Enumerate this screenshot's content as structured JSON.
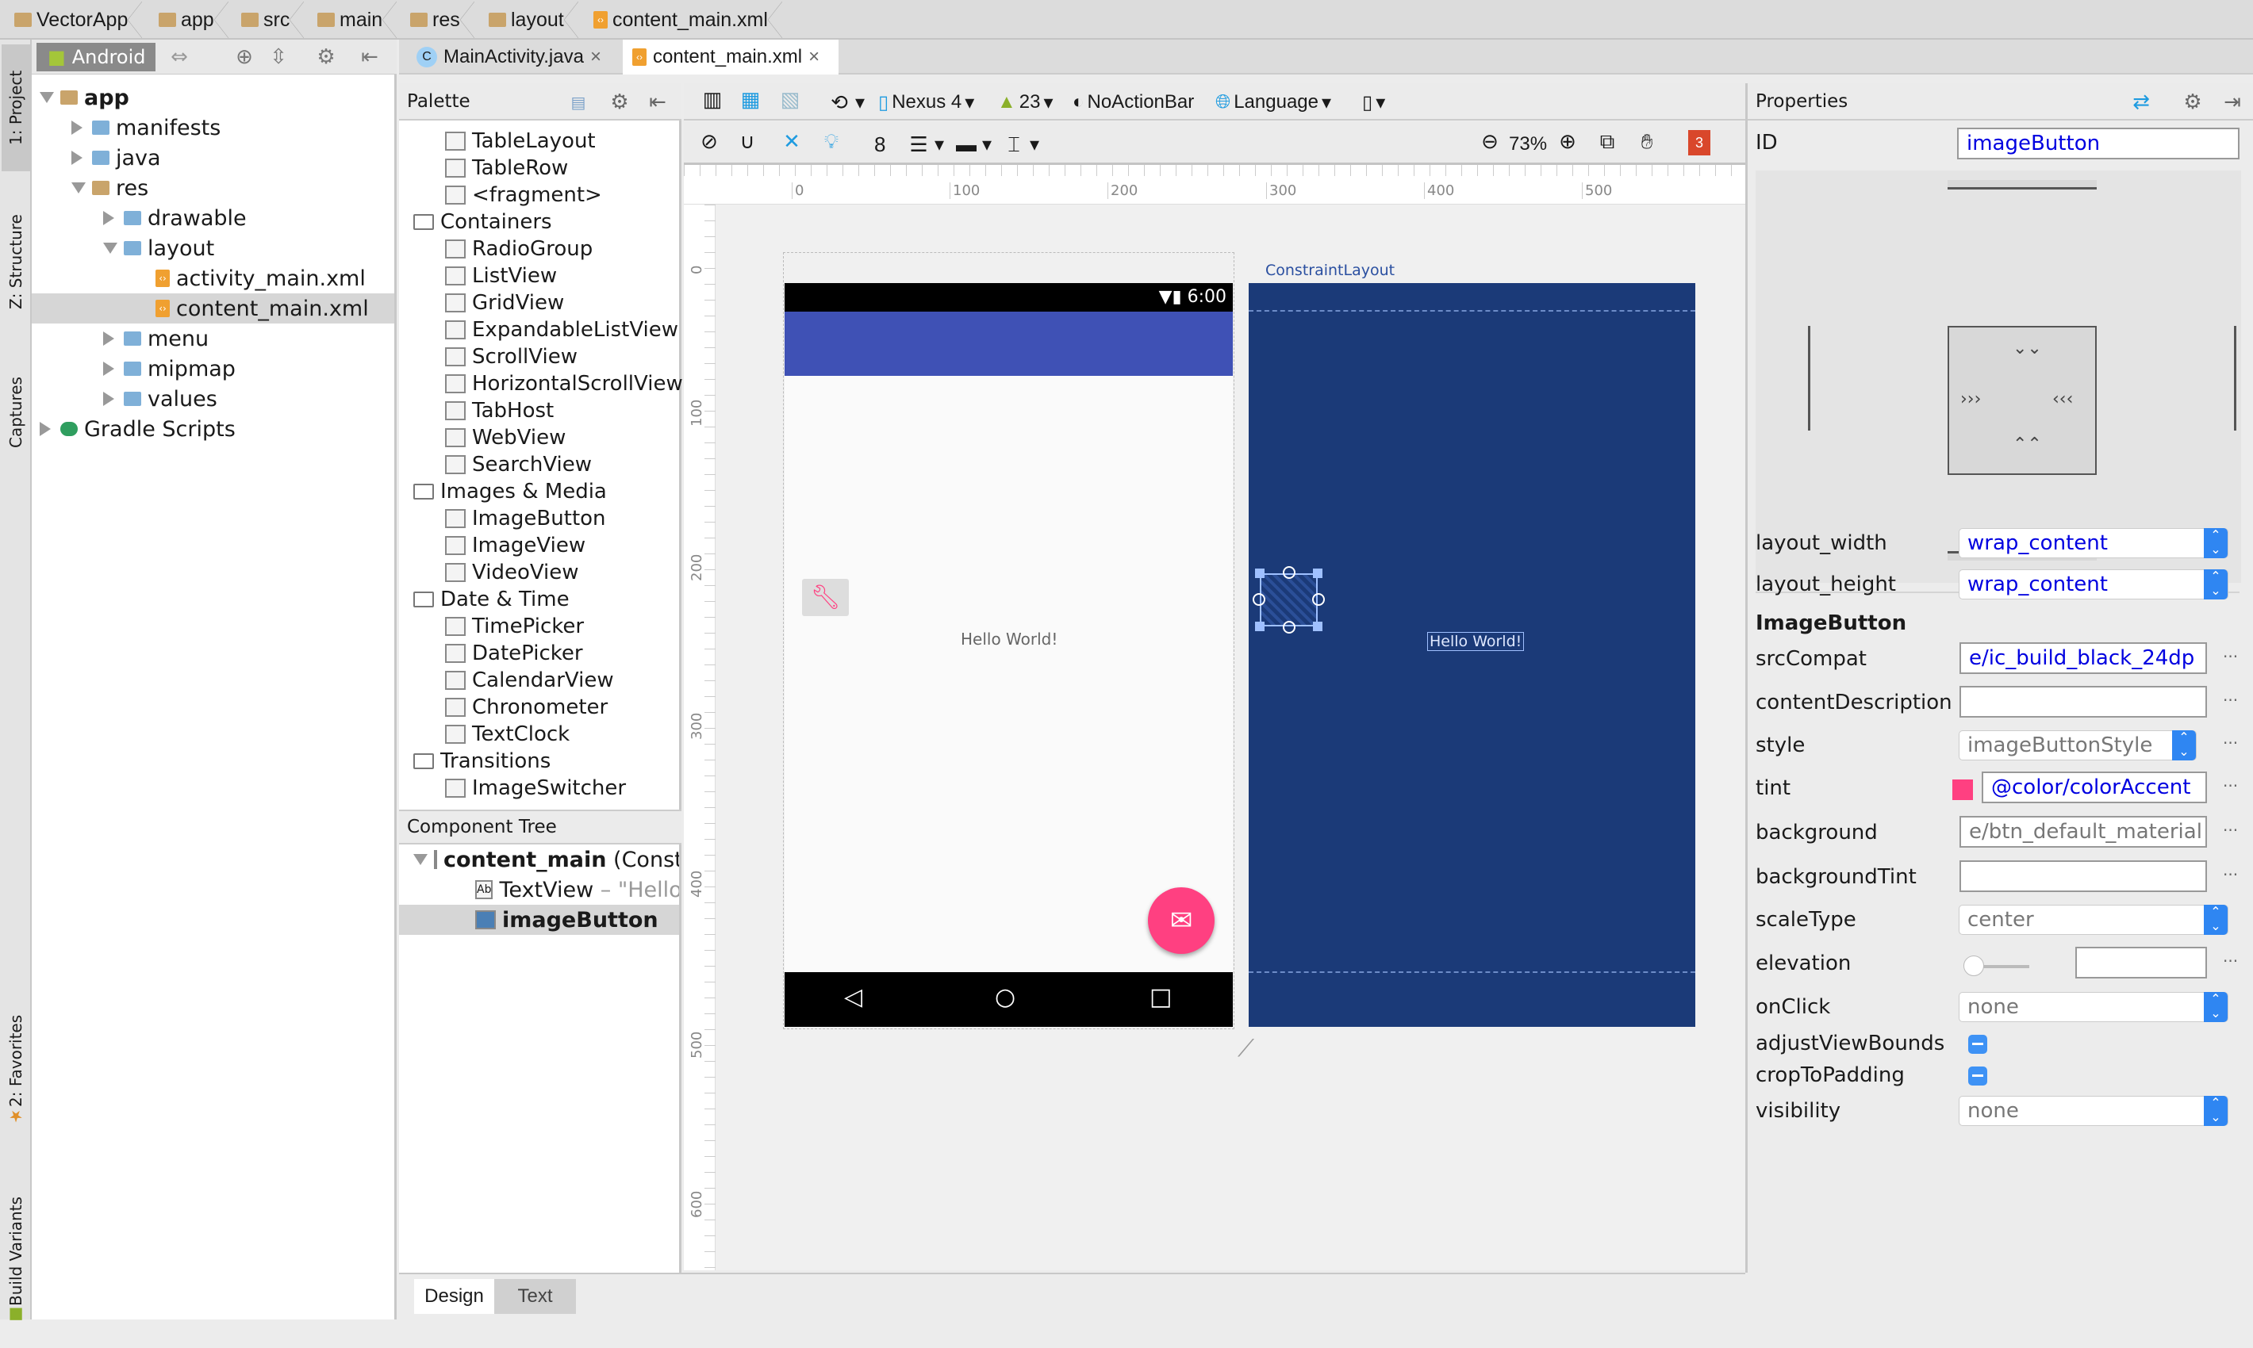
{
  "breadcrumbs": [
    "VectorApp",
    "app",
    "src",
    "main",
    "res",
    "layout",
    "content_main.xml"
  ],
  "tool_strip": {
    "project": "1: Project",
    "structure": "Z: Structure",
    "captures": "Captures",
    "favorites": "2: Favorites",
    "build_variants": "Build Variants"
  },
  "project": {
    "view_mode": "Android",
    "tree": [
      {
        "label": "app",
        "level": 0,
        "state": "open",
        "bold": true,
        "icon": "module-folder"
      },
      {
        "label": "manifests",
        "level": 1,
        "state": "closed",
        "icon": "folder"
      },
      {
        "label": "java",
        "level": 1,
        "state": "closed",
        "icon": "folder"
      },
      {
        "label": "res",
        "level": 1,
        "state": "open",
        "icon": "res-folder"
      },
      {
        "label": "drawable",
        "level": 2,
        "state": "closed",
        "icon": "folder"
      },
      {
        "label": "layout",
        "level": 2,
        "state": "open",
        "icon": "folder"
      },
      {
        "label": "activity_main.xml",
        "level": 3,
        "state": "leaf",
        "icon": "xml-file"
      },
      {
        "label": "content_main.xml",
        "level": 3,
        "state": "leaf",
        "icon": "xml-file",
        "selected": true
      },
      {
        "label": "menu",
        "level": 2,
        "state": "closed",
        "icon": "folder"
      },
      {
        "label": "mipmap",
        "level": 2,
        "state": "closed",
        "icon": "folder"
      },
      {
        "label": "values",
        "level": 2,
        "state": "closed",
        "icon": "folder"
      },
      {
        "label": "Gradle Scripts",
        "level": 0,
        "state": "closed",
        "icon": "gradle"
      }
    ]
  },
  "editor_tabs": [
    {
      "label": "MainActivity.java",
      "active": false
    },
    {
      "label": "content_main.xml",
      "active": true
    }
  ],
  "palette": {
    "title": "Palette",
    "items": [
      {
        "label": "TableLayout"
      },
      {
        "label": "TableRow"
      },
      {
        "label": "<fragment>"
      },
      {
        "label": "Containers",
        "group": true
      },
      {
        "label": "RadioGroup"
      },
      {
        "label": "ListView"
      },
      {
        "label": "GridView"
      },
      {
        "label": "ExpandableListView"
      },
      {
        "label": "ScrollView"
      },
      {
        "label": "HorizontalScrollView"
      },
      {
        "label": "TabHost"
      },
      {
        "label": "WebView"
      },
      {
        "label": "SearchView"
      },
      {
        "label": "Images & Media",
        "group": true
      },
      {
        "label": "ImageButton"
      },
      {
        "label": "ImageView"
      },
      {
        "label": "VideoView"
      },
      {
        "label": "Date & Time",
        "group": true
      },
      {
        "label": "TimePicker"
      },
      {
        "label": "DatePicker"
      },
      {
        "label": "CalendarView"
      },
      {
        "label": "Chronometer"
      },
      {
        "label": "TextClock"
      },
      {
        "label": "Transitions",
        "group": true
      },
      {
        "label": "ImageSwitcher"
      }
    ]
  },
  "component_tree": {
    "title": "Component Tree",
    "root": "content_main",
    "root_suffix": "(ConstraintLayout)",
    "children": [
      {
        "label": "TextView",
        "suffix": "– \"Hello World!\""
      },
      {
        "label": "imageButton",
        "selected": true
      }
    ]
  },
  "toolbar": {
    "device": "Nexus 4",
    "api": "23",
    "theme": "NoActionBar",
    "language": "Language",
    "margin": "8",
    "zoom": "73%",
    "warnings": "3"
  },
  "rulers": {
    "horizontal": [
      "0",
      "100",
      "200",
      "300",
      "400",
      "500"
    ],
    "vertical": [
      "0",
      "100",
      "200",
      "300",
      "400",
      "500",
      "600"
    ]
  },
  "design": {
    "status_time": "6:00",
    "hello_text": "Hello World!",
    "blueprint_label": "ConstraintLayout",
    "colors": {
      "primary": "#3F51B5",
      "accent": "#FF4081",
      "blueprint": "#1B3A78"
    }
  },
  "properties": {
    "title": "Properties",
    "id_label": "ID",
    "id_value": "imageButton",
    "layout_width": {
      "label": "layout_width",
      "value": "wrap_content"
    },
    "layout_height": {
      "label": "layout_height",
      "value": "wrap_content"
    },
    "section": "ImageButton",
    "srcCompat": {
      "label": "srcCompat",
      "value": "e/ic_build_black_24dp"
    },
    "contentDescription": {
      "label": "contentDescription",
      "value": ""
    },
    "style": {
      "label": "style",
      "value": "imageButtonStyle"
    },
    "tint": {
      "label": "tint",
      "value": "@color/colorAccent",
      "swatch": "#FF4081"
    },
    "background": {
      "label": "background",
      "value": "e/btn_default_material"
    },
    "backgroundTint": {
      "label": "backgroundTint",
      "value": ""
    },
    "scaleType": {
      "label": "scaleType",
      "value": "center"
    },
    "elevation": {
      "label": "elevation",
      "value": "",
      "slider": 0
    },
    "onClick": {
      "label": "onClick",
      "value": "none"
    },
    "adjustViewBounds": {
      "label": "adjustViewBounds",
      "state": "indeterminate"
    },
    "cropToPadding": {
      "label": "cropToPadding",
      "state": "indeterminate"
    },
    "visibility": {
      "label": "visibility",
      "value": "none"
    }
  },
  "bottom_tabs": [
    {
      "label": "Design",
      "active": true
    },
    {
      "label": "Text",
      "active": false
    }
  ]
}
